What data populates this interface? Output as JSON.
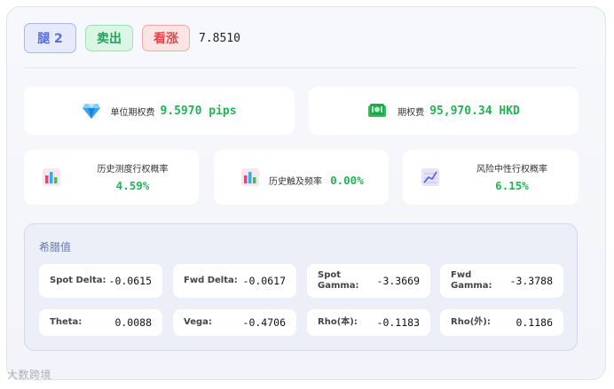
{
  "header": {
    "leg_label": "腿 2",
    "side_label": "卖出",
    "direction_label": "看涨",
    "rate": "7.8510"
  },
  "premium_per_unit": {
    "icon": "diamond-icon",
    "label": "单位期权费",
    "value": "9.5970 pips"
  },
  "premium_total": {
    "icon": "cash-icon",
    "label": "期权费",
    "value": "95,970.34 HKD"
  },
  "stats": [
    {
      "icon": "bar-chart-icon",
      "label": "历史测度行权概率",
      "value": "4.59%"
    },
    {
      "icon": "bar-chart-icon",
      "label": "历史触及频率",
      "value": "0.00%"
    },
    {
      "icon": "line-chart-icon",
      "label": "风险中性行权概率",
      "value": "6.15%"
    }
  ],
  "greeks": {
    "title": "希腊值",
    "items": [
      {
        "label": "Spot Delta:",
        "value": "-0.0615"
      },
      {
        "label": "Fwd Delta:",
        "value": "-0.0617"
      },
      {
        "label": "Spot Gamma:",
        "value": "-3.3669"
      },
      {
        "label": "Fwd Gamma:",
        "value": "-3.3788"
      },
      {
        "label": "Theta:",
        "value": "0.0088"
      },
      {
        "label": "Vega:",
        "value": "-0.4706"
      },
      {
        "label": "Rho(本):",
        "value": "-0.1183"
      },
      {
        "label": "Rho(外):",
        "value": "0.1186"
      }
    ]
  },
  "colors": {
    "accent": "#5a6fd6",
    "sell_green": "#1fa55a",
    "bull_red": "#e04848",
    "value_green": "#22b455"
  },
  "watermark": "大数跨境"
}
